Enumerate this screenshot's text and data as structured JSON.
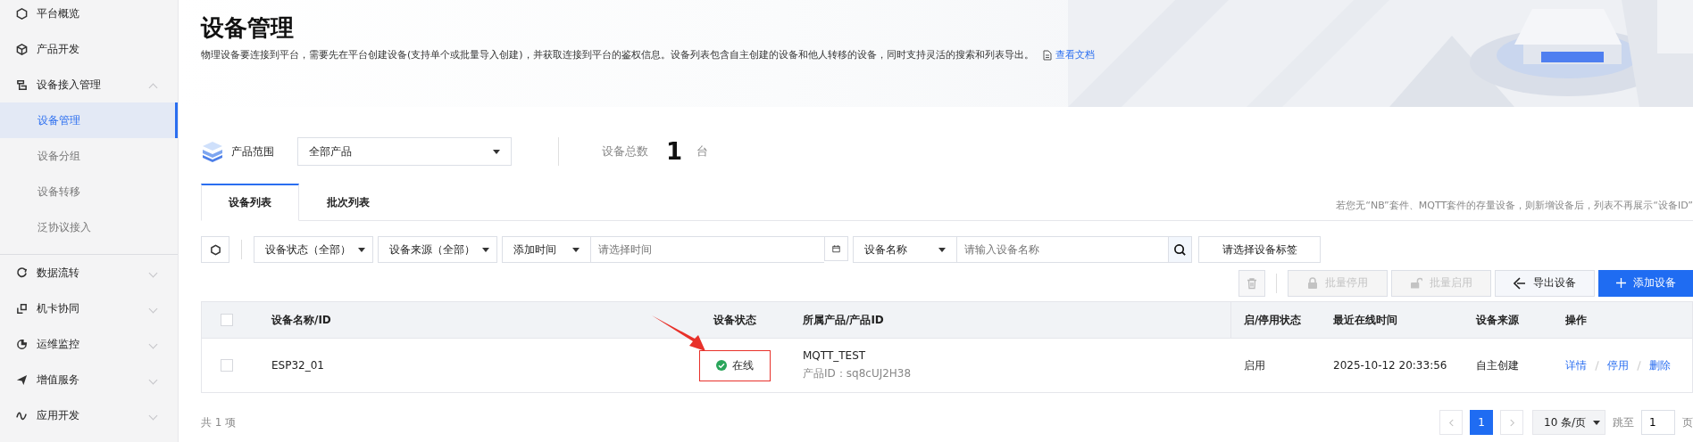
{
  "sidebar": {
    "items": [
      {
        "label": "平台概览",
        "kind": "link"
      },
      {
        "label": "产品开发",
        "kind": "link"
      },
      {
        "label": "设备接入管理",
        "kind": "group",
        "expanded": true,
        "children": [
          {
            "label": "设备管理",
            "selected": true
          },
          {
            "label": "设备分组",
            "selected": false
          },
          {
            "label": "设备转移",
            "selected": false
          },
          {
            "label": "泛协议接入",
            "selected": false
          }
        ]
      },
      {
        "label": "数据流转",
        "kind": "group",
        "expanded": false
      },
      {
        "label": "机卡协同",
        "kind": "group",
        "expanded": false
      },
      {
        "label": "运维监控",
        "kind": "group",
        "expanded": false
      },
      {
        "label": "增值服务",
        "kind": "group",
        "expanded": false
      },
      {
        "label": "应用开发",
        "kind": "group",
        "expanded": false
      }
    ]
  },
  "page": {
    "title": "设备管理",
    "description": "物理设备要连接到平台，需要先在平台创建设备(支持单个或批量导入创建)，并获取连接到平台的鉴权信息。设备列表包含自主创建的设备和他人转移的设备，同时支持灵活的搜索和列表导出。",
    "doc_link": "查看文档"
  },
  "summary": {
    "product_label": "产品范围",
    "product_select": "全部产品",
    "total_label": "设备总数",
    "total": "1",
    "total_unit": "台"
  },
  "tabs": [
    {
      "label": "设备列表",
      "selected": true
    },
    {
      "label": "批次列表",
      "selected": false
    }
  ],
  "tabs_note": "若您无“NB”套件、MQTT套件的存量设备，则新增设备后，列表不再展示“设备ID”",
  "filters": {
    "status": "设备状态（全部）",
    "source": "设备来源（全部）",
    "time_field": "添加时间",
    "time_placeholder": "请选择时间",
    "name_field": "设备名称",
    "name_placeholder": "请输入设备名称",
    "tag_placeholder": "请选择设备标签"
  },
  "delete_disabled": true,
  "toolbar": [
    {
      "label": "批量停用",
      "kind": "lock",
      "disabled": true
    },
    {
      "label": "批量启用",
      "kind": "unlock",
      "disabled": true
    },
    {
      "label": "导出设备",
      "kind": "export",
      "disabled": false
    },
    {
      "label": "添加设备",
      "kind": "add",
      "disabled": false
    }
  ],
  "table": {
    "header_checked": false,
    "columns": [
      "设备名称/ID",
      "设备状态",
      "所属产品/产品ID",
      "启/停用状态",
      "最近在线时间",
      "设备来源",
      "操作"
    ],
    "rows": [
      {
        "checked": false,
        "name": "ESP32_01",
        "status": "在线",
        "online": true,
        "highlighted": true,
        "product": "MQTT_TEST",
        "product_id": "产品ID：sq8cUJ2H38",
        "enabled": "启用",
        "last_online": "2025-10-12 20:33:56",
        "source": "自主创建",
        "actions": [
          "详情",
          "停用",
          "删除"
        ]
      }
    ]
  },
  "pagination": {
    "total": "共 1 项",
    "pages": [
      {
        "label": "1",
        "selected": true
      }
    ],
    "page_size": "10 条/页",
    "jump_label": "跳至",
    "jump_value": "1",
    "page_unit": "页"
  }
}
